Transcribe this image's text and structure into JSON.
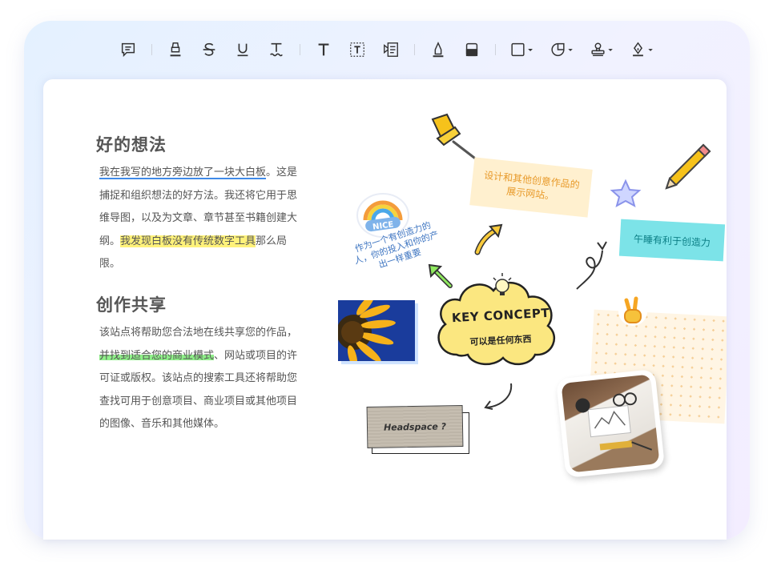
{
  "toolbar": {
    "items": [
      {
        "name": "comment-note-tool",
        "icon": "comment-note-icon"
      },
      {
        "name": "highlight-tool",
        "icon": "highlighter-icon"
      },
      {
        "name": "strikethrough-tool",
        "icon": "strikethrough-icon"
      },
      {
        "name": "underline-tool",
        "icon": "underline-icon"
      },
      {
        "name": "squiggly-underline-tool",
        "icon": "squiggly-underline-icon"
      },
      {
        "name": "text-tool",
        "icon": "text-icon"
      },
      {
        "name": "text-box-tool",
        "icon": "text-box-icon"
      },
      {
        "name": "callout-tool",
        "icon": "callout-icon"
      },
      {
        "name": "pencil-tool",
        "icon": "pencil-icon"
      },
      {
        "name": "eraser-tool",
        "icon": "eraser-icon"
      },
      {
        "name": "shape-tool",
        "icon": "rectangle-icon"
      },
      {
        "name": "sticker-tool",
        "icon": "sticker-icon"
      },
      {
        "name": "stamp-tool",
        "icon": "stamp-icon"
      },
      {
        "name": "signature-tool",
        "icon": "signature-pen-icon"
      }
    ]
  },
  "content": {
    "section1": {
      "heading": "好的想法",
      "underlined": "我在我写的地方旁边放了一块大白板",
      "text1": "。这是捕捉和组织想法的好方法。我还将它用于思维导图，以及为文章、章节甚至书籍创建大纲。",
      "highlighted": "我发现白板没有传统数字工具",
      "text2": "那么局限。"
    },
    "section2": {
      "heading": "创作共享",
      "text1": "该站点将帮助您合法地在线共享您的作品，",
      "highlighted": "并找到适合您的商业模式",
      "text2": "、网站或项目的许可证或版权。该站点的搜索工具还将帮助您查找可用于创意项目、商业项目或其他项目的图像、音乐和其他媒体。"
    }
  },
  "whiteboard": {
    "note_orange": "设计和其他创意作品的展示网站。",
    "note_cyan": "午睡有利于创造力",
    "blue_note": "作为一个有创造力的人，你的投入和你的产出一样重要",
    "nice_sticker": "NICE",
    "concept_title": "KEY CONCEPT",
    "concept_sub": "可以是任何东西",
    "headspace": "Headspace ?"
  },
  "colors": {
    "accent_blue": "#3f8ae8",
    "highlight_yellow": "#fff27a",
    "highlight_green": "#8ff089",
    "note_orange_text": "#e89a2a",
    "note_cyan_bg": "#7ce3e8",
    "cloud_yellow": "#fbe780"
  }
}
